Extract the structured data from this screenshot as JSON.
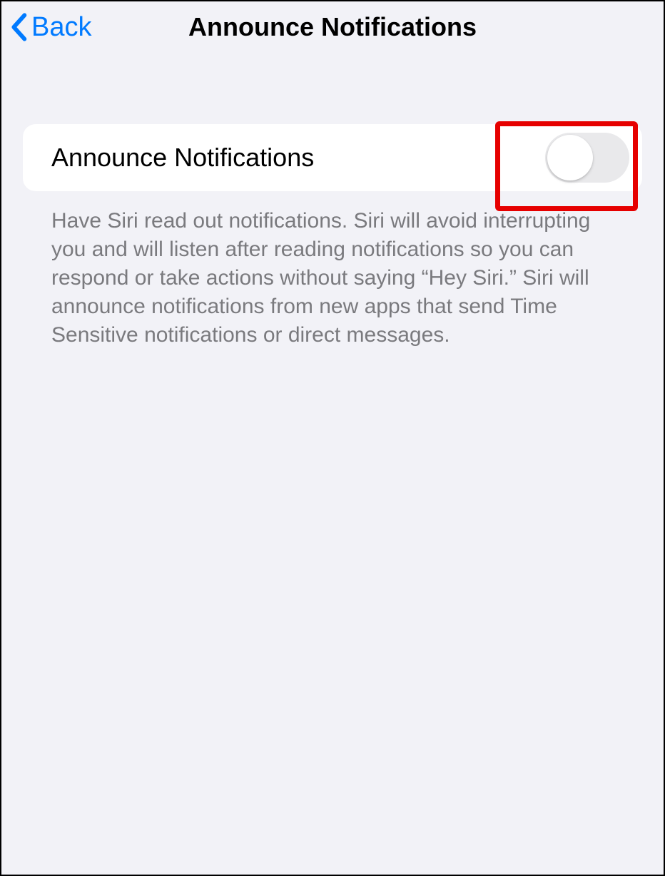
{
  "nav": {
    "back_label": "Back",
    "title": "Announce Notifications"
  },
  "setting": {
    "label": "Announce Notifications",
    "toggle_on": false
  },
  "description": "Have Siri read out notifications. Siri will avoid interrupting you and will listen after reading notifications so you can respond or take actions without saying “Hey Siri.” Siri will announce notifications from new apps that send Time Sensitive notifications or direct messages."
}
